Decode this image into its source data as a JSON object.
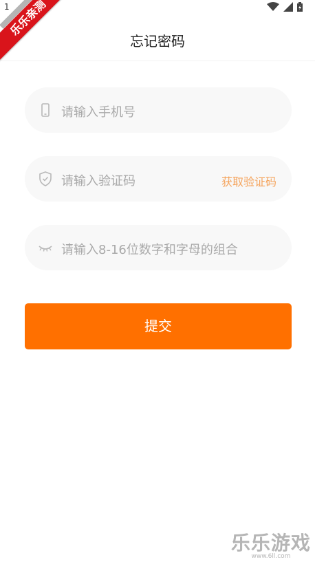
{
  "status": {
    "time": "1"
  },
  "ribbon": {
    "text": "乐乐亲测"
  },
  "header": {
    "title": "忘记密码"
  },
  "form": {
    "phone_placeholder": "请输入手机号",
    "code_placeholder": "请输入验证码",
    "get_code_label": "获取验证码",
    "password_placeholder": "请输入8-16位数字和字母的组合",
    "submit_label": "提交"
  },
  "watermark": {
    "brand": "乐乐游戏",
    "url": "www.6ll.com"
  },
  "colors": {
    "accent": "#ff7000",
    "link": "#f5a35b"
  },
  "icons": [
    "phone-icon",
    "shield-icon",
    "eye-closed-icon",
    "wifi-icon",
    "signal-icon",
    "battery-icon"
  ]
}
